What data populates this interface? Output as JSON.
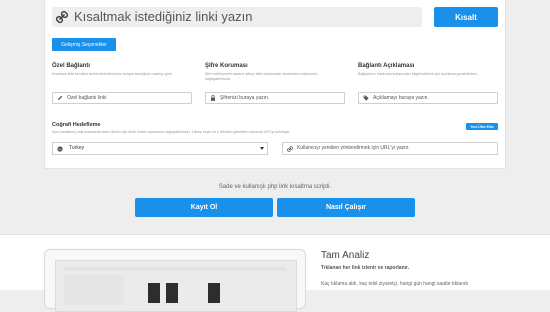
{
  "shortener": {
    "url_placeholder": "Kısaltmak istediğiniz linki yazın",
    "shorten_label": "Kısalt",
    "advanced_label": "Gelişmiş Seçenekler"
  },
  "options": [
    {
      "title": "Özel Bağlantı",
      "desc": "Kısaltılan linki kendiniz belirlemek isterseniz buraya istediğiniz uzantıyı girin.",
      "placeholder": "Özel bağlantı linki",
      "icon": "pencil-icon"
    },
    {
      "title": "Şifre Koruması",
      "desc": "Şifre belirleyerek sadece şifreyi bilen kullanıcılar tarafından erişilmesini sağlayabilirsiniz.",
      "placeholder": "Şifrenizi buraya yazın.",
      "icon": "lock-icon"
    },
    {
      "title": "Bağlantı Açıklaması",
      "desc": "Bağlantınız hakkında kullanıcıları bilgilendirmek için açıklama yazabilirsiniz.",
      "placeholder": "Açıklamayı buraya yazın.",
      "icon": "tag-icon"
    }
  ],
  "geo": {
    "title": "Coğrafi Hedefleme",
    "desc": "Aynı kısaltılmış linki kullanarak farklı ülkeler için farklı linkler açılmasını sağlayabilirsiniz. Ülkeyi seçin ve o ülkeden girenlerin açılacak URL'yi belirleyin.",
    "add_label": "Yeni Ülke Ekle",
    "country": "Turkey",
    "redirect_placeholder": "Kullanıcıyı yeniden yönlendirmek için URL'yi yazın."
  },
  "tagline": "Sade ve kullanışlı php link kısaltma scripti.",
  "buttons": {
    "register": "Kayıt Ol",
    "how": "Nasıl Çalışır"
  },
  "analysis": {
    "title": "Tam Analiz",
    "subtitle": "Tıklanan her link izlenir ve raporlanır.",
    "desc": "Kaç tıklama aldı, kaç tekil ziyaretçi, hangi gün hangi saatte tıklandı"
  },
  "colors": {
    "accent": "#1991eb",
    "background": "#eeeeee"
  }
}
